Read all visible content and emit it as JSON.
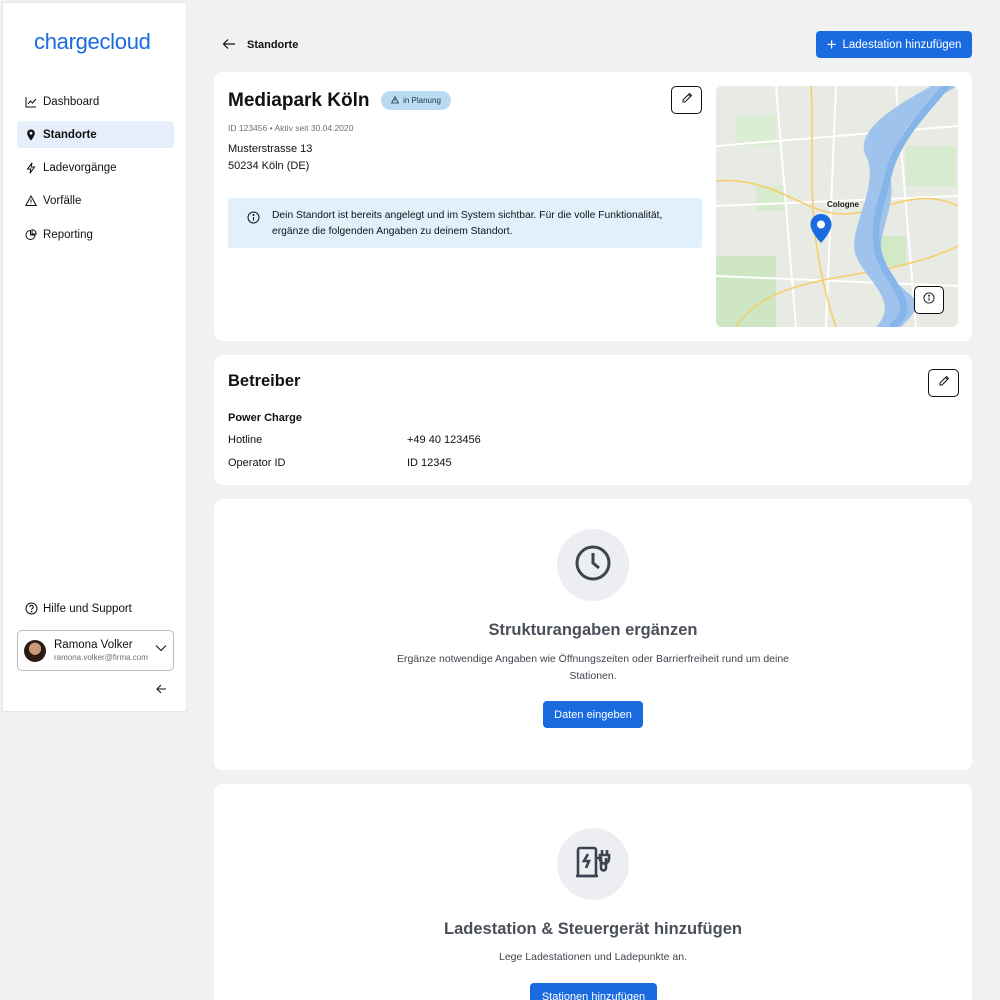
{
  "sidebar": {
    "logo": "chargecloud",
    "items": [
      {
        "label": "Dashboard",
        "icon": "chart-line-icon"
      },
      {
        "label": "Standorte",
        "icon": "map-pin-icon",
        "active": true
      },
      {
        "label": "Ladevorgänge",
        "icon": "lightning-icon"
      },
      {
        "label": "Vorfälle",
        "icon": "warning-icon"
      },
      {
        "label": "Reporting",
        "icon": "pie-chart-icon"
      }
    ],
    "help_label": "Hilfe und Support",
    "user": {
      "name": "Ramona Volker",
      "email": "ramona.volker@firma.com"
    }
  },
  "header": {
    "breadcrumb": "Standorte",
    "add_button": "Ladestation hinzufügen"
  },
  "location": {
    "title": "Mediapark Köln",
    "status": "in Planung",
    "meta": "ID 123456 • Aktiv seit 30.04.2020",
    "street": "Musterstrasse 13",
    "city": "50234 Köln (DE)",
    "info": "Dein Standort ist bereits angelegt und im System sichtbar. Für die volle Funktionalität, ergänze die folgenden Angaben zu deinem Standort.",
    "map_label": "Cologne"
  },
  "operator": {
    "title": "Betreiber",
    "name": "Power Charge",
    "rows": [
      {
        "label": "Hotline",
        "value": "+49 40 123456"
      },
      {
        "label": "Operator ID",
        "value": "ID 12345"
      }
    ]
  },
  "structure": {
    "title": "Strukturangaben ergänzen",
    "description": "Ergänze notwendige Angaben wie Öffnungszeiten oder Barrierfreiheit rund um deine Stationen.",
    "button": "Daten eingeben"
  },
  "stations": {
    "title": "Ladestation & Steuergerät hinzufügen",
    "description": "Lege Ladestationen und Ladepunkte an.",
    "button": "Stationen hinzufügen"
  },
  "colors": {
    "accent": "#1a6be0",
    "info_bg": "#e1f0fb",
    "badge_bg": "#b9dcf3",
    "active_nav": "#e6eefb"
  }
}
